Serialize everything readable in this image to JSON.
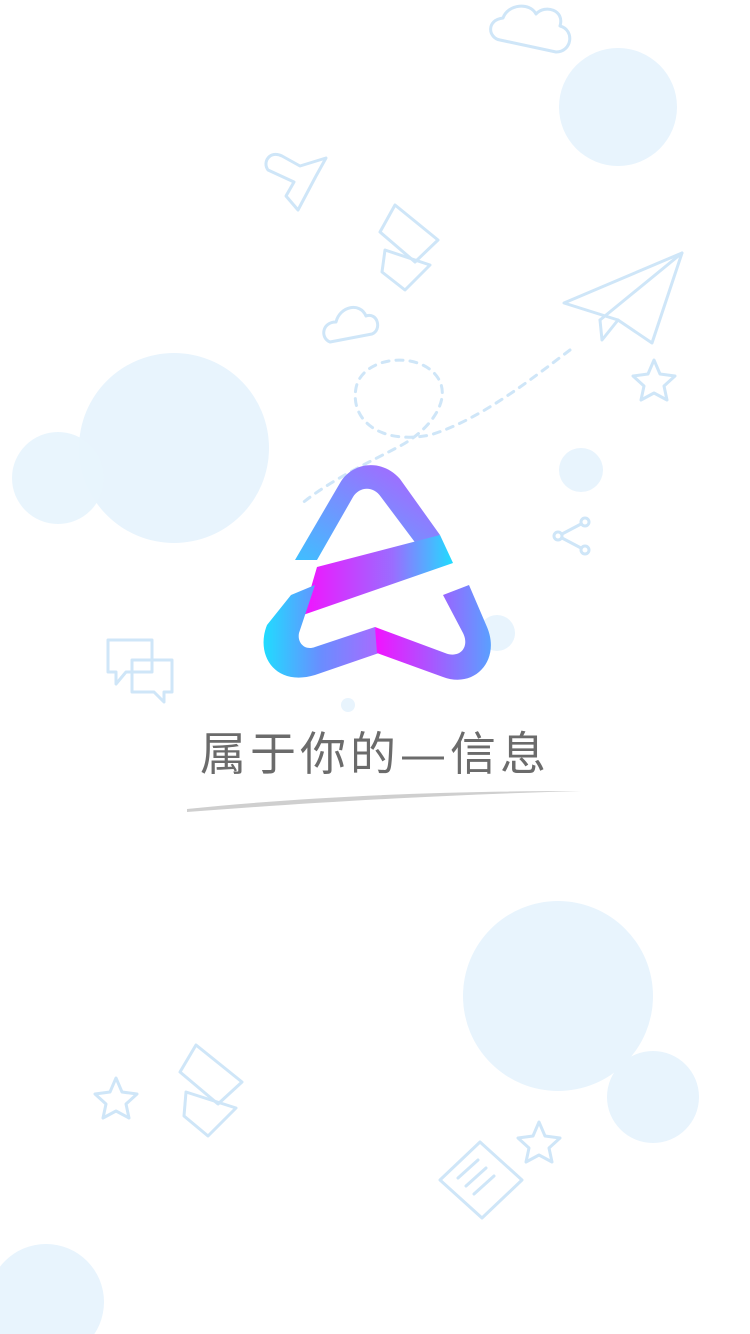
{
  "splash": {
    "tagline": "属于你的—信息",
    "logo_icon": "app-logo-icon",
    "colors": {
      "background": "#ffffff",
      "bubble_fill": "#e8f4fd",
      "outline_stroke": "#cfe6f8",
      "logo_cyan": "#20dcff",
      "logo_purple": "#a86bff",
      "logo_magenta": "#f312ff",
      "tagline_text": "#6b6b6b"
    },
    "decor_icons": [
      "cloud-icon",
      "paper-plane-icon",
      "dashed-flight-path-icon",
      "star-icon",
      "chat-bubble-icon",
      "share-icon",
      "document-icon",
      "bird-icon"
    ]
  }
}
